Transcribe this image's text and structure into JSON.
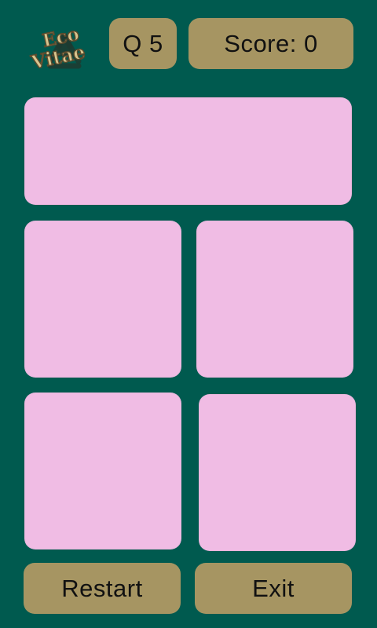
{
  "header": {
    "logo_text": [
      "Eco",
      "Vitae"
    ],
    "question_label": "Q 5",
    "score_label": "Score: 0"
  },
  "game": {
    "question_card_text": "",
    "answer_cards": [
      "",
      "",
      "",
      ""
    ]
  },
  "footer": {
    "restart_label": "Restart",
    "exit_label": "Exit"
  },
  "colors": {
    "background": "#005a4f",
    "button": "#a69562",
    "card": "#f0bce4",
    "logo_text": "#d8c58f",
    "logo_outline": "#5b4b2d",
    "recycle_icon": "#1f3b30"
  },
  "icons": {
    "logo_icon": "recycle-icon"
  }
}
